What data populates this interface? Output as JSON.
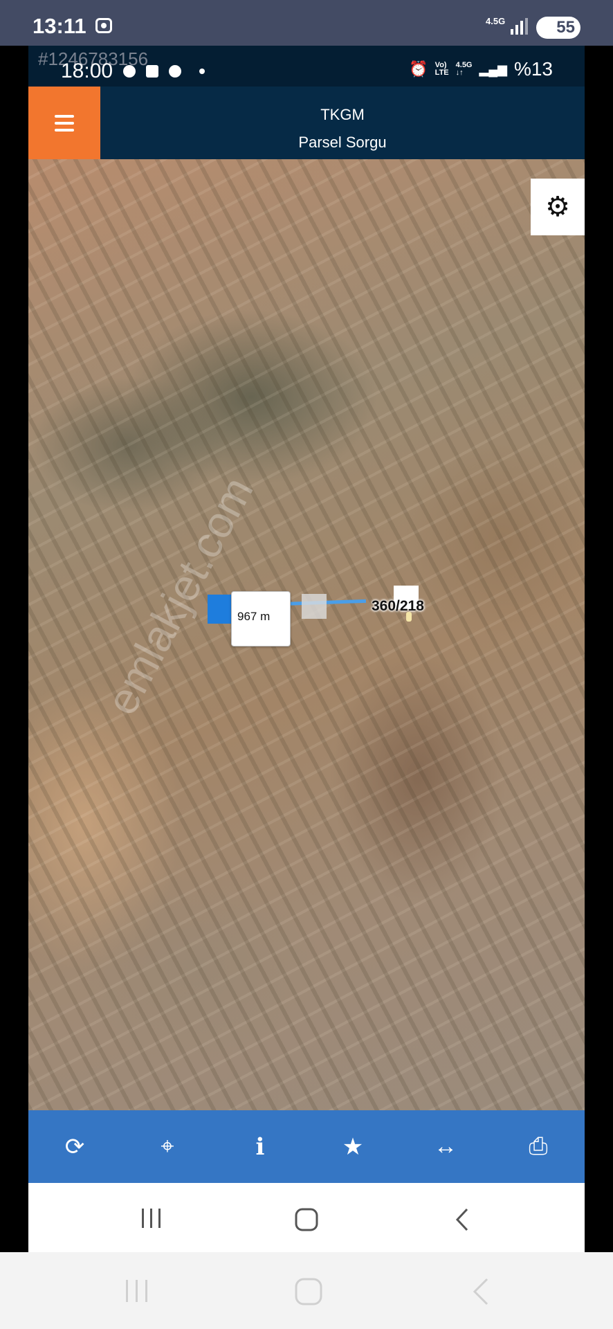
{
  "outer_status": {
    "time": "13:11",
    "network": "4.5G",
    "battery": "55"
  },
  "inner_status": {
    "id_watermark": "#1246783156",
    "time": "18:00",
    "battery": "%13"
  },
  "app": {
    "title": "TKGM",
    "subtitle": "Parsel Sorgu"
  },
  "map": {
    "distance_label": "967 m",
    "parcel_label": "360/218",
    "watermark": "emlakjet.com"
  },
  "toolbar": {
    "items": [
      {
        "name": "refresh-icon",
        "glyph": "⟳"
      },
      {
        "name": "locate-icon",
        "glyph": "⌖"
      },
      {
        "name": "info-icon",
        "glyph": "i"
      },
      {
        "name": "star-icon",
        "glyph": "★"
      },
      {
        "name": "measure-icon",
        "glyph": "↔"
      },
      {
        "name": "print-icon",
        "glyph": "⎙"
      }
    ]
  }
}
